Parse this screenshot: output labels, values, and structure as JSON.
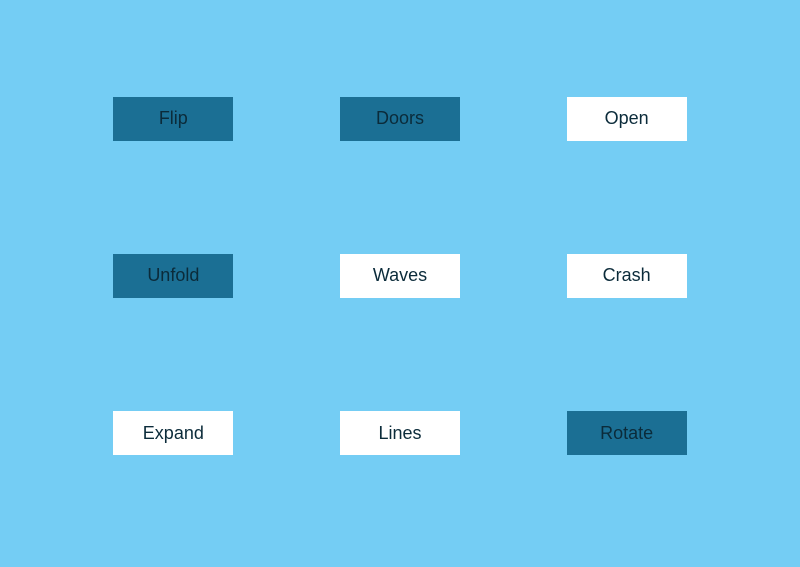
{
  "buttons": [
    {
      "label": "Flip",
      "variant": "dark"
    },
    {
      "label": "Doors",
      "variant": "dark"
    },
    {
      "label": "Open",
      "variant": "light"
    },
    {
      "label": "Unfold",
      "variant": "dark"
    },
    {
      "label": "Waves",
      "variant": "light"
    },
    {
      "label": "Crash",
      "variant": "light"
    },
    {
      "label": "Expand",
      "variant": "light"
    },
    {
      "label": "Lines",
      "variant": "light"
    },
    {
      "label": "Rotate",
      "variant": "dark"
    }
  ],
  "colors": {
    "background": "#74cdf4",
    "button_dark": "#1b6f94",
    "button_light": "#ffffff",
    "text": "#0b2b3a"
  }
}
